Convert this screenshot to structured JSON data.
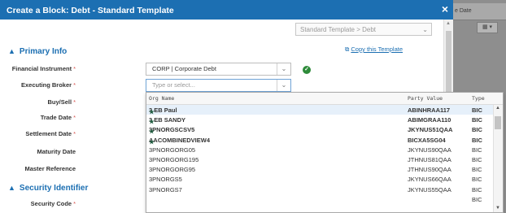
{
  "background": {
    "column_header": "e Date",
    "toolbar_icons": "▦ ▾"
  },
  "modal": {
    "title": "Create a Block: Debt - Standard Template",
    "close_icon": "×",
    "template_selector": {
      "value": "Standard Template > Debt"
    },
    "copy_link": "Copy this Template"
  },
  "sections": {
    "primary_info": "Primary Info",
    "security_identifier": "Security Identifier"
  },
  "fields": {
    "financial_instrument": {
      "label": "Financial Instrument",
      "value": "CORP | Corporate Debt",
      "required": true
    },
    "executing_broker": {
      "label": "Executing Broker",
      "placeholder": "Type or select...",
      "required": true
    },
    "buy_sell": {
      "label": "Buy/Sell",
      "required": true
    },
    "trade_date": {
      "label": "Trade Date",
      "required": true
    },
    "settlement_date": {
      "label": "Settlement Date",
      "required": true
    },
    "maturity_date": {
      "label": "Maturity Date"
    },
    "master_reference": {
      "label": "Master Reference"
    },
    "security_code": {
      "label": "Security Code",
      "required": true
    }
  },
  "required_marker": "*",
  "dropdown": {
    "columns": [
      "Org Name",
      "Party Value",
      "Type"
    ],
    "rows": [
      {
        "org": "3 EB Paul",
        "party": "ABINHRAA117",
        "type": "BIC",
        "favorite": true,
        "highlighted": true
      },
      {
        "org": "3 EB SANDY",
        "party": "ABIMGRAA110",
        "type": "BIC",
        "favorite": true
      },
      {
        "org": "3PNORGSCSV5",
        "party": "JKYNUS51QAA",
        "type": "BIC",
        "favorite": true
      },
      {
        "org": "AACOMBINEDVIEW4",
        "party": "BICXA5SG04",
        "type": "BIC",
        "favorite": true
      },
      {
        "org": "3PNORGORG05",
        "party": "JKYNUS90QAA",
        "type": "BIC",
        "favorite": false
      },
      {
        "org": "3PNORGORG195",
        "party": "JTHNUS81QAA",
        "type": "BIC",
        "favorite": false
      },
      {
        "org": "3PNORGORG95",
        "party": "JTHNUS90QAA",
        "type": "BIC",
        "favorite": false
      },
      {
        "org": "3PNORGS5",
        "party": "JKYNUS66QAA",
        "type": "BIC",
        "favorite": false
      },
      {
        "org": "3PNORGS7",
        "party": "JKYNUS55QAA",
        "type": "BIC",
        "favorite": false
      },
      {
        "org": "",
        "party": "",
        "type": "BIC",
        "favorite": false
      }
    ]
  },
  "colors": {
    "header_blue": "#1c6fb2",
    "required_red": "#d9534f",
    "ok_green": "#2e8b3a"
  }
}
